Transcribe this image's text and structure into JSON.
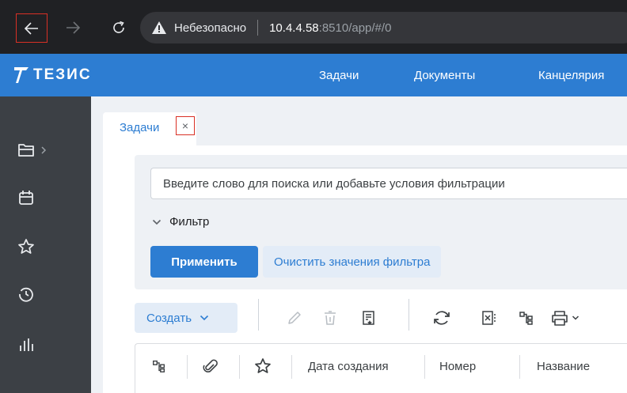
{
  "browser": {
    "insecure_label": "Небезопасно",
    "host": "10.4.4.58",
    "path": ":8510/app/#/0"
  },
  "app": {
    "logo_text": "ТЕЗИС",
    "nav": {
      "tasks": "Задачи",
      "documents": "Документы",
      "office": "Канцелярия"
    }
  },
  "sidebar": {
    "items": [
      {
        "icon": "folder-icon"
      },
      {
        "icon": "calendar-icon"
      },
      {
        "icon": "star-icon"
      },
      {
        "icon": "history-icon"
      },
      {
        "icon": "bar-chart-icon"
      }
    ]
  },
  "tab": {
    "label": "Задачи",
    "close": "×"
  },
  "filter": {
    "search_placeholder": "Введите слово для поиска или добавьте условия фильтрации",
    "toggle_label": "Фильтр",
    "apply_label": "Применить",
    "clear_label": "Очистить значения фильтра"
  },
  "toolbar": {
    "create_label": "Создать"
  },
  "grid": {
    "columns": [
      "Дата создания",
      "Номер",
      "Название"
    ]
  },
  "colors": {
    "accent": "#2d7dd2",
    "sidebar": "#3c4045",
    "browser": "#202124",
    "highlight": "#d93025"
  }
}
